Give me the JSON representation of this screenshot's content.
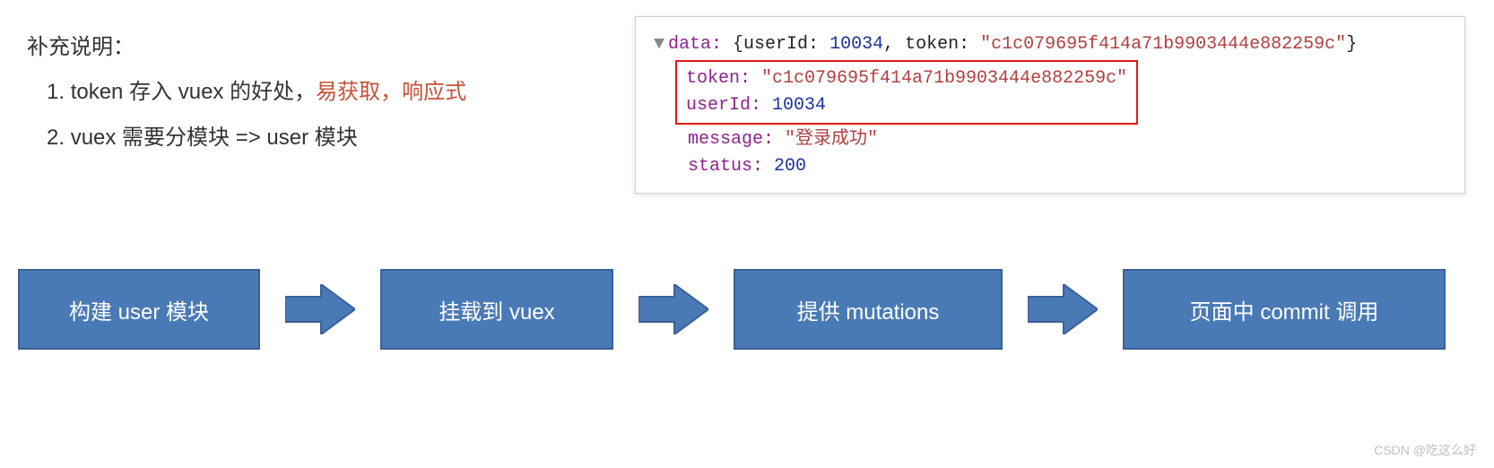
{
  "notes": {
    "title": "补充说明：",
    "item1_prefix": "token 存入 vuex 的好处，",
    "item1_highlight": "易获取，响应式",
    "item2": "vuex 需要分模块 => user 模块"
  },
  "console": {
    "data_key": "data:",
    "data_summary_open": " {userId: ",
    "data_userId_val": "10034",
    "data_summary_mid": ", token: ",
    "data_token_summary": "\"c1c079695f414a71b9903444e882259c\"",
    "data_summary_close": "}",
    "token_key": "token: ",
    "token_val": "\"c1c079695f414a71b9903444e882259c\"",
    "userId_key": "userId: ",
    "userId_val": "10034",
    "message_key": "message: ",
    "message_val": "\"登录成功\"",
    "status_key": "status: ",
    "status_val": "200"
  },
  "flow": {
    "step1": "构建 user 模块",
    "step2": "挂载到 vuex",
    "step3": "提供 mutations",
    "step4": "页面中 commit 调用"
  },
  "watermark": "CSDN @吃这么好"
}
